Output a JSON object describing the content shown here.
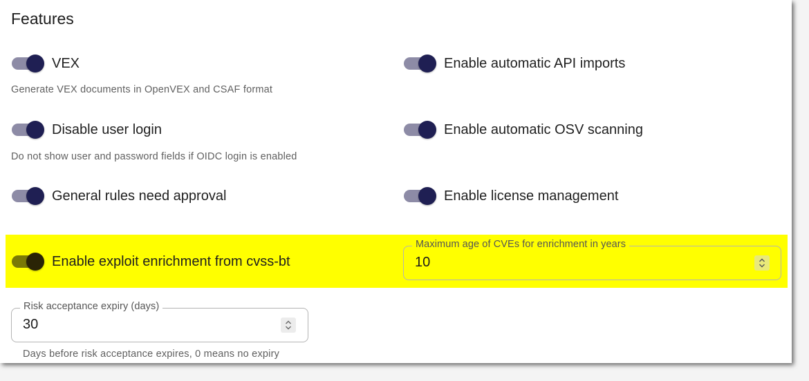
{
  "section": {
    "title": "Features"
  },
  "features": {
    "vex": {
      "label": "VEX",
      "hint": "Generate VEX documents in OpenVEX and CSAF format",
      "enabled": true
    },
    "api_imports": {
      "label": "Enable automatic API imports",
      "enabled": true
    },
    "disable_login": {
      "label": "Disable user login",
      "hint": "Do not show user and password fields if OIDC login is enabled",
      "enabled": true
    },
    "osv_scanning": {
      "label": "Enable automatic OSV scanning",
      "enabled": true
    },
    "rules_approval": {
      "label": "General rules need approval",
      "enabled": true
    },
    "license_mgmt": {
      "label": "Enable license management",
      "enabled": true
    },
    "exploit_enrichment": {
      "label": "Enable exploit enrichment from cvss-bt",
      "enabled": true
    }
  },
  "fields": {
    "max_cve_age": {
      "label": "Maximum age of CVEs for enrichment in years",
      "value": "10"
    },
    "risk_expiry": {
      "label": "Risk acceptance expiry (days)",
      "value": "30",
      "hint": "Days before risk acceptance expires, 0 means no expiry"
    }
  },
  "colors": {
    "highlight": "#ffff00",
    "switch_thumb": "#1f1f53",
    "switch_track": "#8d8ba6"
  },
  "icons": {
    "spinner": "spinner-up-down-icon"
  }
}
